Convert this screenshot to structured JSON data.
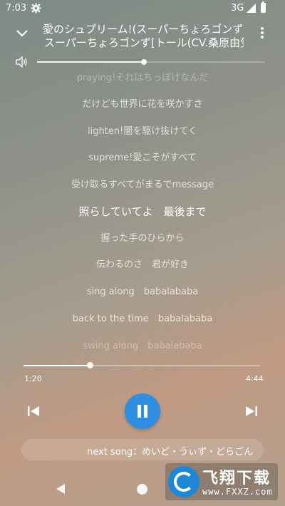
{
  "status_bar": {
    "time": "7:03",
    "network": "3G"
  },
  "header": {
    "title": "愛のシュプリーム!(スーパーちょろゴンず",
    "artist": "スーパーちょろゴンず[トール(CV.桑原由気)..."
  },
  "volume": {
    "level": 0.47
  },
  "lyrics": [
    "praying!それはちっぽけなんだ",
    "だけども世界に花を咲かすさ",
    "lighten!闇を駆け抜けてく",
    "supreme!愛こそがすべて",
    "受け取るすべてがまるでmessage",
    "照らしていてよ　最後まで",
    "握った手のひらから",
    "伝わるのさ　君が好き",
    "sing along　babalababa",
    "back to the time　babalababa",
    "swing along　babalababa"
  ],
  "current_lyric_index": 5,
  "progress": {
    "elapsed": "1:20",
    "duration": "4:44",
    "fraction": 0.28
  },
  "next_song": "next song：めいど・うぃず・どらごん",
  "watermark": {
    "title": "飞翔下载",
    "url": "www.FXXZ.com"
  },
  "colors": {
    "accent": "#2f8ee0"
  }
}
